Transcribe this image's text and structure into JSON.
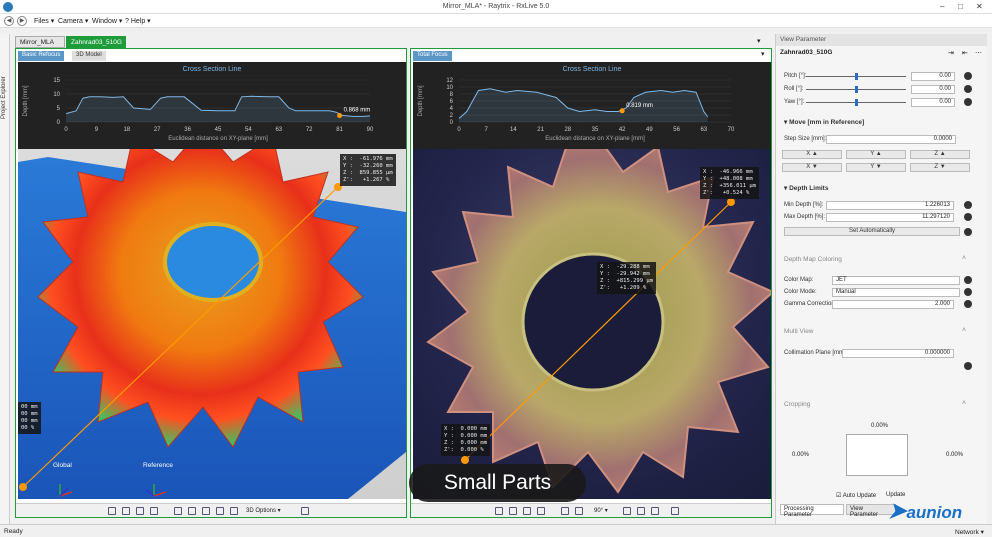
{
  "window": {
    "title": "Mirror_MLA* - Raytrix - RxLive 5.0"
  },
  "menu": {
    "files": "Files ▾",
    "camera": "Camera ▾",
    "window": "Window ▾",
    "help": "? Help ▾"
  },
  "doc_tabs": [
    "Mirror_MLA",
    "Zahnrad03_510G"
  ],
  "left_strip": "Project Explorer",
  "left_panel": {
    "tabs": [
      "Basic Refocus",
      "3D Model"
    ],
    "chart_title": "Cross Section Line",
    "xlabel": "Euclidean distance on XY-plane [mm]",
    "ylabel": "Depth [mm]",
    "marker_label": "0.868 mm",
    "readout_top": "X :  -61.976 mm\nY :  -32.260 mm\nZ :  859.855 µm\nZ':   +1.267 %",
    "readout_left": "00 mm\n00 mm\n00 mm\n00 %",
    "axis_global": "Global",
    "axis_reference": "Reference",
    "toolbar_3d": "3D Options ▾"
  },
  "right_panel": {
    "tabs": [
      "Total Focus"
    ],
    "chart_title": "Cross Section Line",
    "xlabel": "Euclidean distance on XY-plane [mm]",
    "ylabel": "Depth [mm]",
    "marker_label": "0.819 mm",
    "readout_top": "X :  -46.966 mm\nY :  +48.008 mm\nZ :  +356.011 µm\nZ':   +0.524 %",
    "readout_mid": "X :  -29.288 mm\nY :  -29.942 mm\nZ :  +815.299 µm\nZ':   +1.209 %",
    "readout_bottom": "X :  0.000 mm\nY :  0.000 mm\nZ :  0.000 mm\nZ':  0.000 %",
    "rotate": "90° ▾"
  },
  "chart_data": [
    {
      "type": "line",
      "title": "Cross Section Line",
      "xlabel": "Euclidean distance on XY-plane [mm]",
      "ylabel": "Depth [mm]",
      "xticks": [
        "0",
        "9",
        "18",
        "27",
        "36",
        "45",
        "54",
        "63",
        "72",
        "81",
        "90"
      ],
      "yticks": [
        "0",
        "5",
        "10",
        "15"
      ],
      "xlim": [
        0,
        90
      ],
      "ylim": [
        0,
        15
      ],
      "x": [
        0,
        3,
        5,
        7,
        10,
        14,
        17,
        20,
        25,
        28,
        30,
        35,
        40,
        45,
        50,
        52,
        55,
        60,
        63,
        66,
        68,
        72,
        76,
        78,
        80,
        82,
        85,
        88,
        90
      ],
      "y": [
        3,
        4,
        8.5,
        9,
        9,
        8.8,
        9,
        5,
        4.5,
        8.5,
        9,
        9,
        4.2,
        4,
        4,
        9,
        9.2,
        9,
        9,
        5,
        4,
        4,
        4,
        4,
        3.5,
        2.3,
        2,
        2,
        2.2
      ]
    },
    {
      "type": "line",
      "title": "Cross Section Line",
      "xlabel": "Euclidean distance on XY-plane [mm]",
      "ylabel": "Depth [mm]",
      "xticks": [
        "0",
        "7",
        "14",
        "21",
        "28",
        "35",
        "42",
        "49",
        "56",
        "63",
        "70"
      ],
      "yticks": [
        "0",
        "2",
        "4",
        "6",
        "8",
        "10",
        "12"
      ],
      "xlim": [
        0,
        70
      ],
      "ylim": [
        0,
        12
      ],
      "x": [
        0,
        2,
        5,
        8,
        12,
        15,
        20,
        25,
        28,
        31,
        35,
        38,
        41,
        43,
        45,
        48,
        52,
        55,
        58,
        61,
        63,
        64
      ],
      "y": [
        1,
        3,
        9,
        9.5,
        8.5,
        9,
        8.5,
        7,
        4,
        3,
        3.5,
        3,
        3,
        4,
        7,
        8.5,
        9,
        8.5,
        9,
        8.5,
        3,
        1.5
      ]
    }
  ],
  "view_param": {
    "header": "View Parameter",
    "name": "Zahnrad03_510G",
    "pitch_label": "Pitch [°]:",
    "pitch": "0.00",
    "roll_label": "Roll [°]:",
    "roll": "0.00",
    "yaw_label": "Yaw [°]:",
    "yaw": "0.00",
    "move_section": "Move [mm in Reference]",
    "step_label": "Step Size [mm]:",
    "step": "0.0000",
    "x_btn": "X",
    "y_btn": "Y",
    "z_btn": "Z",
    "depth_section": "Depth Limits",
    "min_label": "Min Depth [%]:",
    "min": "1.226013",
    "max_label": "Max Depth [%]:",
    "max": "11.297120",
    "set_auto": "Set Automatically",
    "coloring_section": "Depth Map Coloring",
    "colormap_label": "Color Map:",
    "colormap": "JET",
    "colormode_label": "Color Mode:",
    "colormode": "Manual",
    "gamma_label": "Gamma Correction:",
    "gamma": "2.000",
    "multi_section": "Multi View",
    "collim_label": "Collimation Plane [mm]:",
    "collim": "0.000000",
    "crop_section": "Cropping",
    "crop_top": "0.00%",
    "crop_left": "0.00%",
    "crop_right": "0.00%",
    "crop_bottom": "0.00%",
    "auto_update": "Auto Update",
    "update": "Update",
    "tab_processing": "Processing Parameter",
    "tab_view": "View Parameter"
  },
  "status": {
    "left": "Ready",
    "right": "Network ▾"
  },
  "overlay_caption": "Small Parts",
  "brand": "aunion",
  "colors": {
    "accent_green": "#1e9c3a",
    "chart_line": "#7fb8e6",
    "marker": "#ff9900"
  }
}
